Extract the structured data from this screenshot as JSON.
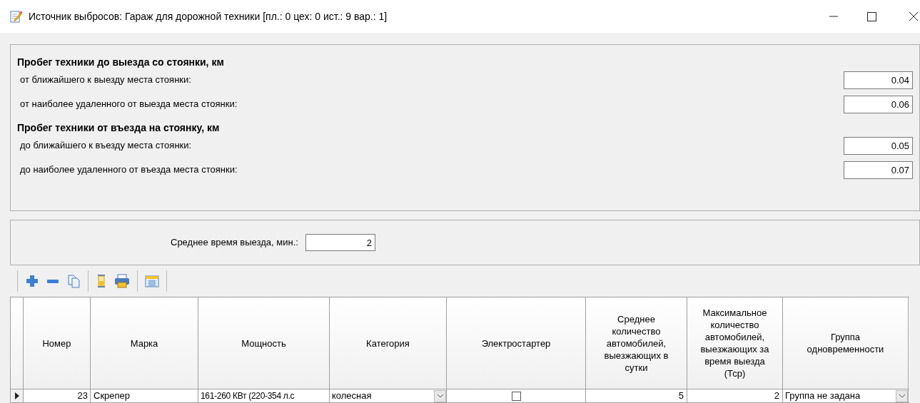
{
  "window": {
    "title": "Источник выбросов: Гараж для дорожной техники [пл.: 0 цех: 0 ист.: 9 вар.: 1]"
  },
  "mileage_groups": [
    {
      "heading": "Пробег техники до выезда со стоянки, км",
      "fields": [
        {
          "label": "от ближайшего к выезду места стоянки:",
          "value": "0.04"
        },
        {
          "label": "от наиболее удаленного от выезда места стоянки:",
          "value": "0.06"
        }
      ]
    },
    {
      "heading": "Пробег техники от въезда на стоянку, км",
      "fields": [
        {
          "label": "до ближайшего к въезду места стоянки:",
          "value": "0.05"
        },
        {
          "label": "до наиболее удаленного от въезда места стоянки:",
          "value": "0.07"
        }
      ]
    }
  ],
  "departure_time": {
    "label": "Среднее время выезда, мин.:",
    "value": "2"
  },
  "table": {
    "columns": [
      "Номер",
      "Марка",
      "Мощность",
      "Категория",
      "Электростартер",
      "Среднее количество автомобилей, выезжающих в сутки",
      "Максимальное количество автомобилей, выезжающих за время выезда (Тср)",
      "Группа одновременности"
    ],
    "rows": [
      {
        "selected": true,
        "number": "23",
        "brand": "Скрепер",
        "power": "161-260 КВт (220-354 л.с",
        "category": "колесная",
        "electric_starter": false,
        "per_day": "5",
        "per_period": "2",
        "group": "Группа не задана"
      }
    ]
  }
}
